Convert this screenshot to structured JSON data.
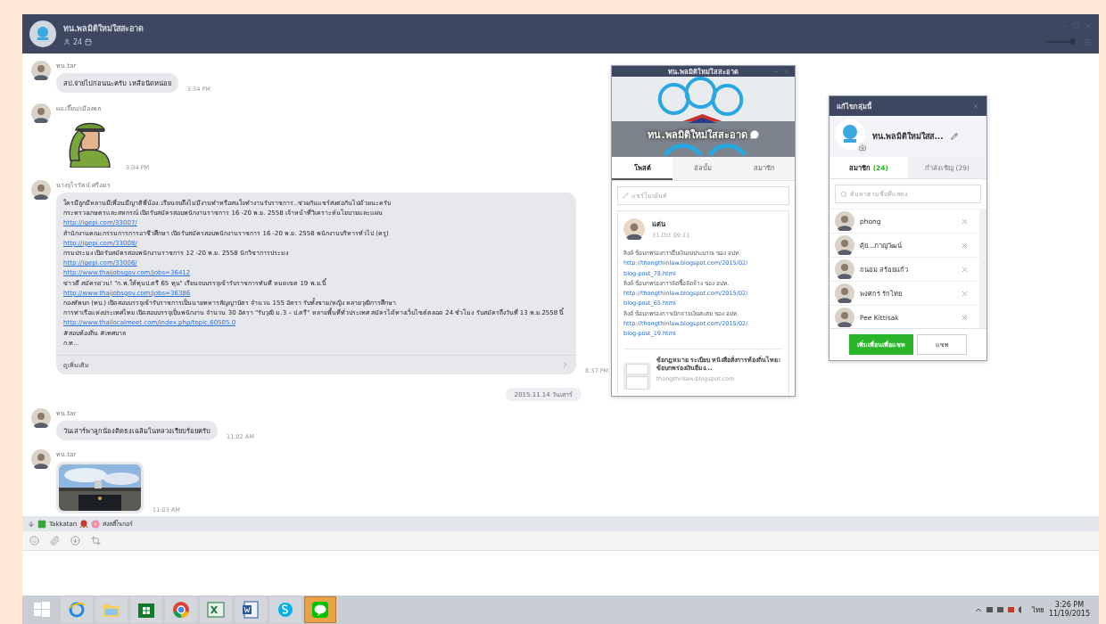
{
  "header": {
    "title": "ทน.พลมิติใหม่ใสสะอาด",
    "member_count": "24",
    "zoom": {
      "level": 0.85
    }
  },
  "messages": [
    {
      "kind": "text",
      "sender": "ทน.tar",
      "text": "สป.จ่ายไปก่อนนะครับ เหลือนิดหน่อย",
      "time": "3:34 PM"
    },
    {
      "kind": "sticker",
      "sender": "ผอ.เจี๊ยบ/เมืองพล",
      "time": "3:34 PM"
    },
    {
      "kind": "long",
      "sender": "นางจุไรรัตน์ ศรีอมร",
      "more": "ดูเพิ่มเติม",
      "time": "8:37 PM",
      "lines": [
        {
          "kind": "text",
          "text": "ใครมีลูกมีหลานมีเพื่อนมีญาติพี่น้อง..เรียนจบถึงไม่มีงานทำหรือสนใจทำงานรับราชการ..ช่วยกันแชร์ส่งต่อกันไปด้วยนะครับ"
        },
        {
          "kind": "text",
          "text": "กระทรวงเกษตรและสหกรณ์ เปิดรับสมัครสอบพนักงานราชการ 16 -20 พ.ย. 2558  เจ้าหน้าที่วิเคราะห์นโยบายและแผน"
        },
        {
          "kind": "link",
          "text": "http://igepi.com/33007/"
        },
        {
          "kind": "text",
          "text": "สำนักงานคณะกรรมการการอาชีวศึกษา เปิดรับสมัครสอบพนักงานราชการ 16 -20 พ.ย. 2558  พนักงานบริหารทั่วไป (ครู)"
        },
        {
          "kind": "link",
          "text": "http://igepi.com/33008/"
        },
        {
          "kind": "text",
          "text": "กรมประมง เปิดรับสมัครสอบพนักงานราชการ 12 -20 พ.ย. 2558  นักวิชาการประมง"
        },
        {
          "kind": "link",
          "text": "http://igepi.com/33006/"
        },
        {
          "kind": "link",
          "text": "http://www.thaijobsgov.com/jobs=36412"
        },
        {
          "kind": "text",
          "text": "ข่าวดี สมัครด่วน! \"ก.พ.ให้ทุนป.ตรี 65 ทุน\" เรียนจบบรรจุเข้ารับราชการทันที หมดเขต 19 พ.ย.นี้"
        },
        {
          "kind": "link",
          "text": "http://www.thaijobsgov.com/jobs=36386"
        },
        {
          "kind": "text",
          "text": "กองทัพบก (ทบ.) เปิดสอบบรรจุเข้ารับราชการเป็นนายทหารสัญญาบัตร จำนวน 155 อัตรา รับทั้งชาย/หญิง หลายวุฒิการศึกษา"
        },
        {
          "kind": "text",
          "text": "การท่าเรือแห่งประเทศไทย เปิดสอบบรรจุเป็นพนักงาน จำนวน 30 อัตรา \"รับวุฒิ ม.3 – ป.ตรี\" หลายพื้นที่ทั่วประเทศ สมัครได้ทางเว็บไซต์ตลอด 24 ชั่วโมง รับสมัครถึงวันที่ 13 พ.ย.2558 นี้"
        },
        {
          "kind": "link",
          "text": "http://www.thailocalmeet.com/index.php/topic,60505.0"
        },
        {
          "kind": "text",
          "text": "#สอบท้องถิ่น #เทศบาล"
        },
        {
          "kind": "text",
          "text": "ก.ท..."
        }
      ]
    },
    {
      "kind": "date",
      "text": "2015.11.14 วันเสาร์"
    },
    {
      "kind": "text",
      "sender": "ทน.tar",
      "text": "วันเสาร์พาลูกน้องติดธงเฉลิมในหลวงเรียบร้อยครับ",
      "time": "11:02 AM"
    },
    {
      "sender": "ทน.tar",
      "time": "11:03 AM"
    }
  ],
  "sticker_bar": {
    "items": [
      "Takkatan",
      "ส่งสติ๊กเกอร์"
    ]
  },
  "post_window": {
    "title": "ทน.พลมิติใหม่ใสสะอาด",
    "cover_title": "ทน.พลมิติใหม่ใสสะอาด",
    "tabs": [
      {
        "label": "โพสต์",
        "selected": true
      },
      {
        "label": "อัลบั้ม",
        "selected": false
      },
      {
        "label": "สมาชิก",
        "selected": false
      }
    ],
    "comment": {
      "placeholder": "แชร์โมเม้นต์"
    },
    "post": {
      "author": "แต่น",
      "time": "31 Oct 09:11",
      "lines": [
        {
          "kind": "text",
          "text": "ลิงค์  ข้อบกพร่องการยืมเงินงบประมาณ  ของ  อปท."
        },
        {
          "kind": "link",
          "text": "http://thongthinlaw.blogspot.com/2015/02/"
        },
        {
          "kind": "link",
          "text": "blog-post_78.html"
        },
        {
          "kind": "text",
          "text": "ลิงค์  ข้อบกพร่องการจัดซื้อจัดจ้าง  ของ  อปท."
        },
        {
          "kind": "link",
          "text": "http://thongthinlaw.blogspot.com/2015/02/"
        },
        {
          "kind": "link",
          "text": "blog-post_65.html"
        },
        {
          "kind": "text",
          "text": "ลิงค์  ข้อบกพร่องการเบิกจ่ายเงินสะสม ของ อปท."
        },
        {
          "kind": "link",
          "text": "http://thongthinlaw.blogspot.com/2015/02/"
        },
        {
          "kind": "link",
          "text": "blog-post_19.html"
        }
      ],
      "preview": {
        "title": "ข้อกฎหมาย ระเบียบ หนังสือสั่งการท้องถิ่นไทย: ข้อบกพร่องเงินยืมง...",
        "site": "thongthinlaw.blogspot.com"
      }
    }
  },
  "group_window": {
    "title": "แก้ไขกลุ่มนี้",
    "name": "ทน.พลมิติใหม่ใสส...",
    "tabs": [
      {
        "label": "สมาชิก",
        "count": "(24)",
        "selected": true
      },
      {
        "label": "กำลังเชิญ",
        "count": "(29)",
        "selected": false
      }
    ],
    "search": {
      "placeholder": "ค้นหาตามชื่อที่แสดง"
    },
    "members": [
      {
        "name": "phong"
      },
      {
        "name": "ตุ้ย...ภาญวัฒน์"
      },
      {
        "name": "ถนอม  สร้อยแก้ว"
      },
      {
        "name": "พงศกร รักไทย"
      },
      {
        "name": "Pee Kittisak"
      }
    ],
    "buttons": [
      {
        "label": "เพิ่มเพื่อนเพื่อแชท",
        "kind": "primary"
      },
      {
        "label": "แชท",
        "kind": "secondary"
      }
    ]
  },
  "taskbar": {
    "apps": [
      {
        "kind": "browser",
        "selected": false
      },
      {
        "kind": "folder",
        "selected": false
      },
      {
        "kind": "store",
        "selected": false
      },
      {
        "kind": "chrome",
        "selected": false
      },
      {
        "kind": "sheet",
        "selected": false
      },
      {
        "kind": "doc",
        "selected": false
      },
      {
        "kind": "skype",
        "selected": false
      },
      {
        "kind": "line",
        "selected": true
      }
    ],
    "language": "ไทย",
    "time": "3:26 PM",
    "date": "11/19/2015"
  }
}
